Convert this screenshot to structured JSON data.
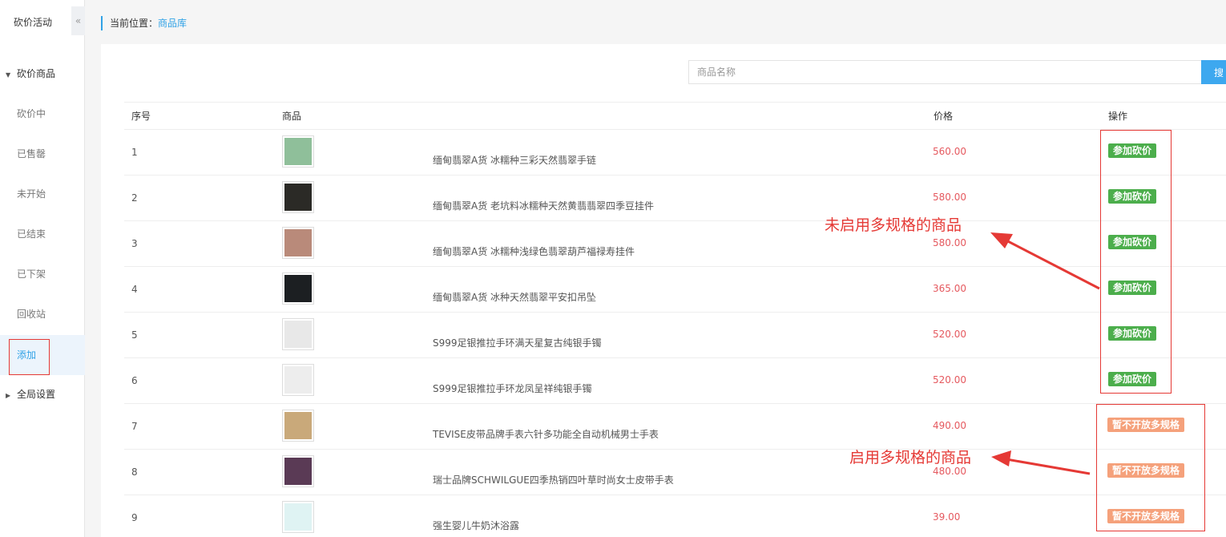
{
  "app": {
    "title": "砍价活动",
    "collapse_icon": "«"
  },
  "sidebar": {
    "group_main": {
      "label": "砍价商品",
      "caret": "▼"
    },
    "items": [
      {
        "label": "砍价中"
      },
      {
        "label": "已售罄"
      },
      {
        "label": "未开始"
      },
      {
        "label": "已结束"
      },
      {
        "label": "已下架"
      },
      {
        "label": "回收站"
      },
      {
        "label": "添加",
        "active": true
      }
    ],
    "group_settings": {
      "label": "全局设置",
      "caret": "▶"
    }
  },
  "breadcrumb": {
    "prefix": "当前位置：",
    "current": "商品库"
  },
  "search": {
    "placeholder": "商品名称",
    "button_label": "搜"
  },
  "table": {
    "headers": {
      "index": "序号",
      "product": "商品",
      "price": "价格",
      "action": "操作"
    },
    "rows": [
      {
        "index": "1",
        "name": "缅甸翡翠A货 冰糯种三彩天然翡翠手链",
        "price": "560.00",
        "action": "参加砍价",
        "thumb_color": "#8fbf9a"
      },
      {
        "index": "2",
        "name": "缅甸翡翠A货 老坑料冰糯种天然黄翡翡翠四季豆挂件",
        "price": "580.00",
        "action": "参加砍价",
        "thumb_color": "#2b2a26"
      },
      {
        "index": "3",
        "name": "缅甸翡翠A货 冰糯种浅绿色翡翠葫芦福禄寿挂件",
        "price": "580.00",
        "action": "参加砍价",
        "thumb_color": "#b98a7a"
      },
      {
        "index": "4",
        "name": "缅甸翡翠A货 冰种天然翡翠平安扣吊坠",
        "price": "365.00",
        "action": "参加砍价",
        "thumb_color": "#1c1f22"
      },
      {
        "index": "5",
        "name": "S999足银推拉手环满天星复古纯银手镯",
        "price": "520.00",
        "action": "参加砍价",
        "thumb_color": "#e8e8e8"
      },
      {
        "index": "6",
        "name": "S999足银推拉手环龙凤呈祥纯银手镯",
        "price": "520.00",
        "action": "参加砍价",
        "thumb_color": "#ededed"
      },
      {
        "index": "7",
        "name": "TEVISE皮带品牌手表六针多功能全自动机械男士手表",
        "price": "490.00",
        "action": "暂不开放多规格",
        "thumb_color": "#c9a97a"
      },
      {
        "index": "8",
        "name": "瑞士品牌SCHWILGUE四季热销四叶草时尚女士皮带手表",
        "price": "480.00",
        "action": "暂不开放多规格",
        "thumb_color": "#5a3a55"
      },
      {
        "index": "9",
        "name": "强生婴儿牛奶沐浴露",
        "price": "39.00",
        "action": "暂不开放多规格",
        "thumb_color": "#dff3f3"
      }
    ]
  },
  "annotations": {
    "single_spec": "未启用多规格的商品",
    "multi_spec": "启用多规格的商品"
  },
  "colors": {
    "accent_blue": "#31a2e6",
    "price_red": "#e5595f",
    "join_green": "#4cae4c",
    "disabled_orange": "#f5a17b",
    "annotation_red": "#e53935"
  }
}
